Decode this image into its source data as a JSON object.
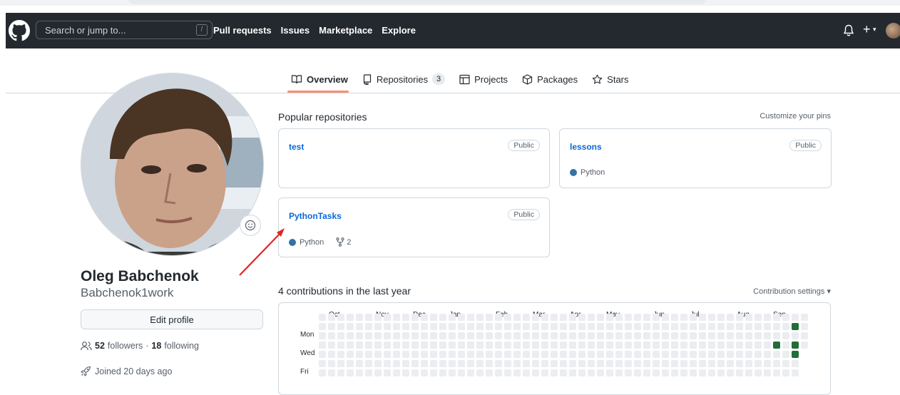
{
  "header": {
    "search_placeholder": "Search or jump to...",
    "slash_key": "/",
    "nav": [
      "Pull requests",
      "Issues",
      "Marketplace",
      "Explore"
    ],
    "plus": "+",
    "caret": "▾"
  },
  "tabs": [
    {
      "label": "Overview",
      "icon": "book-icon"
    },
    {
      "label": "Repositories",
      "icon": "repo-icon",
      "count": "3"
    },
    {
      "label": "Projects",
      "icon": "project-icon"
    },
    {
      "label": "Packages",
      "icon": "package-icon"
    },
    {
      "label": "Stars",
      "icon": "star-icon"
    }
  ],
  "profile": {
    "name": "Oleg Babchenok",
    "login": "Babchenok1work",
    "edit_label": "Edit profile",
    "followers_count": "52",
    "followers_label": "followers",
    "separator": "·",
    "following_count": "18",
    "following_label": "following",
    "joined": "Joined 20 days ago"
  },
  "popular": {
    "title": "Popular repositories",
    "customize": "Customize your pins",
    "repos": [
      {
        "name": "test",
        "visibility": "Public"
      },
      {
        "name": "lessons",
        "visibility": "Public",
        "language": "Python"
      },
      {
        "name": "PythonTasks",
        "visibility": "Public",
        "language": "Python",
        "forks": "2"
      }
    ]
  },
  "contributions": {
    "title": "4 contributions in the last year",
    "settings": "Contribution settings ▾",
    "months": [
      "Oct",
      "Nov",
      "Dec",
      "Jan",
      "Feb",
      "Mar",
      "Apr",
      "May",
      "Jun",
      "Jul",
      "Aug",
      "Sep"
    ],
    "days": [
      "Mon",
      "Wed",
      "Fri"
    ]
  },
  "colors": {
    "header_bg": "#24292f",
    "link": "#0969da",
    "python": "#3572a5",
    "contrib_empty": "#ebedf0",
    "contrib_active": "#216e39",
    "annotation_arrow": "#e02424"
  }
}
